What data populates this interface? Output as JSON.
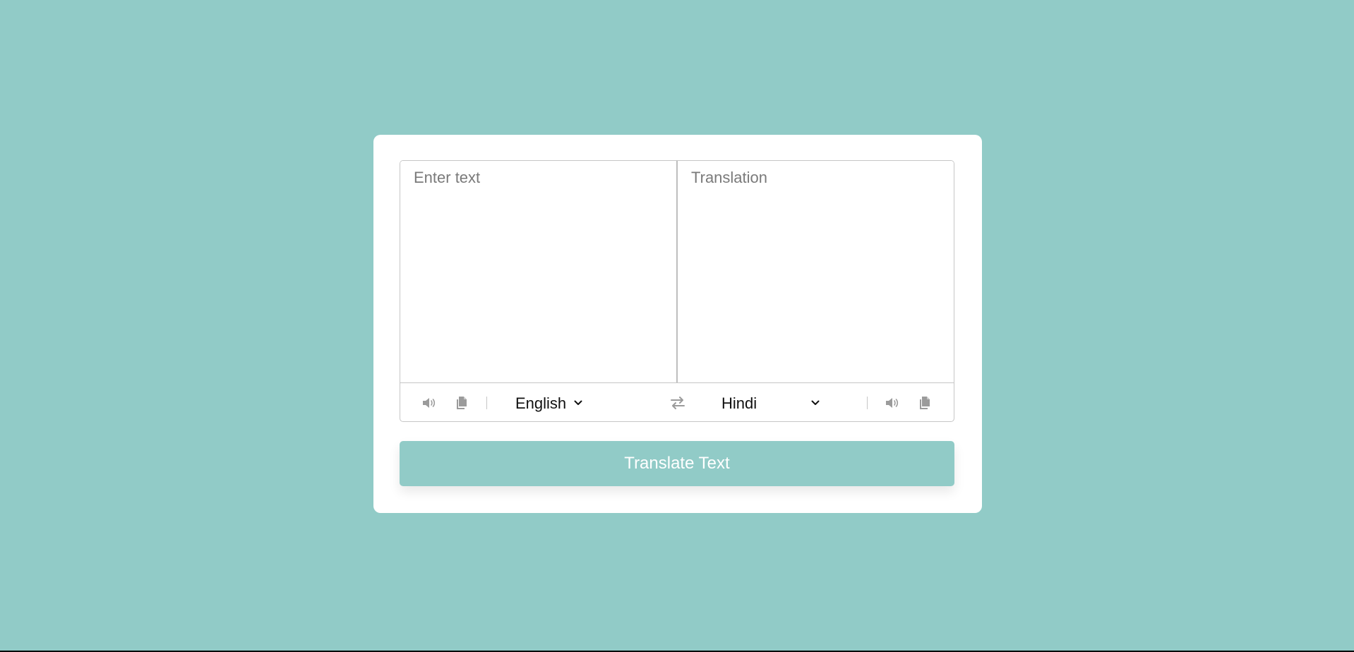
{
  "translator": {
    "from_placeholder": "Enter text",
    "to_placeholder": "Translation",
    "from_language": "English",
    "to_language": "Hindi",
    "translate_button": "Translate Text"
  },
  "icons": {
    "speaker": "speaker-icon",
    "copy": "copy-icon",
    "exchange": "exchange-icon",
    "dropdown": "chevron-down-icon"
  },
  "colors": {
    "background": "#91cbc7",
    "card": "#ffffff",
    "icon": "#9b9b9b",
    "button_text": "#ffffff"
  }
}
